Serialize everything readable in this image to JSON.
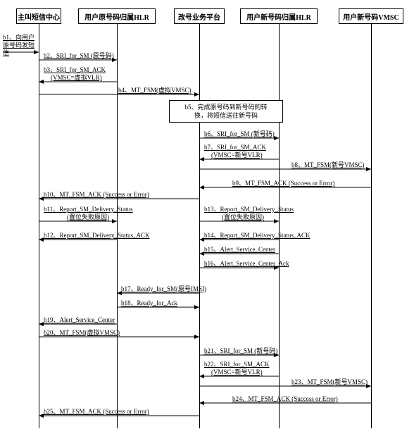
{
  "participants": {
    "p1": "主叫短信中心",
    "p2": "用户原号码归属HLR",
    "p3": "改号业务平台",
    "p4": "用户新号码归属HLR",
    "p5": "用户新号码VMSC"
  },
  "external_msg": "b1、向用户原号码发短信",
  "messages": {
    "m2": "b2、SRI_for_SM (原号码)",
    "m3a": "b3、SRI_for_SM_ACK",
    "m3b": "(VMSC=虚拟VLR)",
    "m4": "b4、MT_FSM(虚拟VMSC)",
    "m6": "b6、SRI_for_SM (新号码)",
    "m7a": "b7、SRI_for_SM_ACK",
    "m7b": "(VMSC=新号VLR)",
    "m8": "b8、MT_FSM(新号VMSC)",
    "m9": "b9、MT_FSM_ACK (Success or Error)",
    "m10": "b10、MT_FSM_ACK (Success or Error)",
    "m11a": "b11、Report_SM_Delivery_Status",
    "m11b": "(置位失败原因)",
    "m12": "b12、Report_SM_Delivery_Status_ACK",
    "m13a": "b13、Report_SM_Delivery_Status",
    "m13b": "(置位失败原因)",
    "m14": "b14、Report_SM_Delivery_Status_ACK",
    "m15": "b15、Alert_Service_Center",
    "m16": "b16、Alert_Service_Center_Ack",
    "m17": "b17、Ready_for_SM(原号IMSI)",
    "m18": "b18、Ready_for_Ack",
    "m19": "b19、Alert_Service_Center",
    "m20": "b20、MT_FSM(虚拟VMSC)",
    "m21": "b21、SRI_for_SM (新号码)",
    "m22a": "b22、SRI_for_SM_ACK",
    "m22b": "(VMSC=新号VLR)",
    "m23": "b23、MT_FSM(新号VMSC)",
    "m24": "b24、MT_FSM_ACK (Success or Error)",
    "m25": "b25、MT_FSM_ACK (Success or Error)"
  },
  "note": "b5、完成原号码到新号码的转\n换，将短信送往新号码",
  "chart_data": {
    "type": "sequence-diagram",
    "participants": [
      "主叫短信中心",
      "用户原号码归属HLR",
      "改号业务平台",
      "用户新号码归属HLR",
      "用户新号码VMSC"
    ],
    "external_event": {
      "to": "主叫短信中心",
      "label": "b1、向用户原号码发短信"
    },
    "messages": [
      {
        "id": "b2",
        "from": "主叫短信中心",
        "to": "用户原号码归属HLR",
        "label": "SRI_for_SM (原号码)"
      },
      {
        "id": "b3",
        "from": "用户原号码归属HLR",
        "to": "主叫短信中心",
        "label": "SRI_for_SM_ACK (VMSC=虚拟VLR)"
      },
      {
        "id": "b4",
        "from": "主叫短信中心",
        "to": "改号业务平台",
        "label": "MT_FSM(虚拟VMSC)"
      },
      {
        "id": "b5",
        "at": "改号业务平台",
        "type": "note",
        "label": "完成原号码到新号码的转换，将短信送往新号码"
      },
      {
        "id": "b6",
        "from": "改号业务平台",
        "to": "用户新号码归属HLR",
        "label": "SRI_for_SM (新号码)"
      },
      {
        "id": "b7",
        "from": "用户新号码归属HLR",
        "to": "改号业务平台",
        "label": "SRI_for_SM_ACK (VMSC=新号VLR)"
      },
      {
        "id": "b8",
        "from": "改号业务平台",
        "to": "用户新号码VMSC",
        "label": "MT_FSM(新号VMSC)"
      },
      {
        "id": "b9",
        "from": "用户新号码VMSC",
        "to": "改号业务平台",
        "label": "MT_FSM_ACK (Success or Error)"
      },
      {
        "id": "b10",
        "from": "改号业务平台",
        "to": "主叫短信中心",
        "label": "MT_FSM_ACK (Success or Error)"
      },
      {
        "id": "b11",
        "from": "主叫短信中心",
        "to": "用户原号码归属HLR",
        "label": "Report_SM_Delivery_Status (置位失败原因)"
      },
      {
        "id": "b12",
        "from": "用户原号码归属HLR",
        "to": "主叫短信中心",
        "label": "Report_SM_Delivery_Status_ACK"
      },
      {
        "id": "b13",
        "from": "改号业务平台",
        "to": "用户新号码归属HLR",
        "label": "Report_SM_Delivery_Status (置位失败原因)"
      },
      {
        "id": "b14",
        "from": "用户新号码归属HLR",
        "to": "改号业务平台",
        "label": "Report_SM_Delivery_Status_ACK"
      },
      {
        "id": "b15",
        "from": "用户新号码归属HLR",
        "to": "改号业务平台",
        "label": "Alert_Service_Center"
      },
      {
        "id": "b16",
        "from": "改号业务平台",
        "to": "用户新号码归属HLR",
        "label": "Alert_Service_Center_Ack"
      },
      {
        "id": "b17",
        "from": "改号业务平台",
        "to": "用户原号码归属HLR",
        "label": "Ready_for_SM(原号IMSI)"
      },
      {
        "id": "b18",
        "from": "用户原号码归属HLR",
        "to": "改号业务平台",
        "label": "Ready_for_Ack"
      },
      {
        "id": "b19",
        "from": "用户原号码归属HLR",
        "to": "主叫短信中心",
        "label": "Alert_Service_Center"
      },
      {
        "id": "b20",
        "from": "主叫短信中心",
        "to": "改号业务平台",
        "label": "MT_FSM(虚拟VMSC)"
      },
      {
        "id": "b21",
        "from": "改号业务平台",
        "to": "用户新号码归属HLR",
        "label": "SRI_for_SM (新号码)"
      },
      {
        "id": "b22",
        "from": "用户新号码归属HLR",
        "to": "改号业务平台",
        "label": "SRI_for_SM_ACK (VMSC=新号VLR)"
      },
      {
        "id": "b23",
        "from": "改号业务平台",
        "to": "用户新号码VMSC",
        "label": "MT_FSM(新号VMSC)"
      },
      {
        "id": "b24",
        "from": "用户新号码VMSC",
        "to": "改号业务平台",
        "label": "MT_FSM_ACK (Success or Error)"
      },
      {
        "id": "b25",
        "from": "改号业务平台",
        "to": "主叫短信中心",
        "label": "MT_FSM_ACK (Success or Error)"
      }
    ]
  }
}
